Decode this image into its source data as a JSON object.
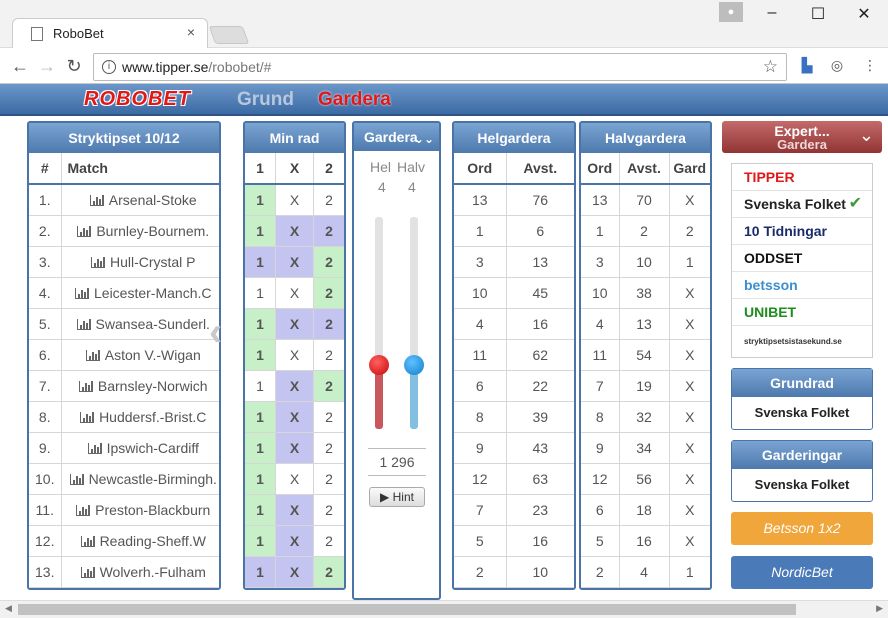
{
  "browser": {
    "tab_title": "RoboBet",
    "url_host": "www.tipper.se",
    "url_path": "/robobet/#"
  },
  "nav": {
    "logo": "ROBOBET",
    "grund": "Grund",
    "gardera": "Gardera"
  },
  "match_panel": {
    "title": "Stryktipset 10/12",
    "col_num": "#",
    "col_match": "Match",
    "rows": [
      {
        "num": "1.",
        "match": "Arsenal-Stoke"
      },
      {
        "num": "2.",
        "match": "Burnley-Bournem."
      },
      {
        "num": "3.",
        "match": "Hull-Crystal P"
      },
      {
        "num": "4.",
        "match": "Leicester-Manch.C"
      },
      {
        "num": "5.",
        "match": "Swansea-Sunderl."
      },
      {
        "num": "6.",
        "match": "Aston V.-Wigan"
      },
      {
        "num": "7.",
        "match": "Barnsley-Norwich"
      },
      {
        "num": "8.",
        "match": "Huddersf.-Brist.C"
      },
      {
        "num": "9.",
        "match": "Ipswich-Cardiff"
      },
      {
        "num": "10.",
        "match": "Newcastle-Birmingh."
      },
      {
        "num": "11.",
        "match": "Preston-Blackburn"
      },
      {
        "num": "12.",
        "match": "Reading-Sheff.W"
      },
      {
        "num": "13.",
        "match": "Wolverh.-Fulham"
      }
    ]
  },
  "minrad": {
    "title": "Min rad",
    "cols": [
      "1",
      "X",
      "2"
    ],
    "rows": [
      [
        "g1",
        "e",
        "e"
      ],
      [
        "g1",
        "bX",
        "b2"
      ],
      [
        "b1",
        "bX",
        "g2"
      ],
      [
        "e",
        "e",
        "g2"
      ],
      [
        "g1",
        "bX",
        "b2"
      ],
      [
        "g1",
        "e",
        "e"
      ],
      [
        "e",
        "bX",
        "g2"
      ],
      [
        "g1",
        "bX",
        "e"
      ],
      [
        "g1",
        "bX",
        "e"
      ],
      [
        "g1",
        "e",
        "e"
      ],
      [
        "g1",
        "bX",
        "e"
      ],
      [
        "g1",
        "bX",
        "e"
      ],
      [
        "b1",
        "bX",
        "g2"
      ]
    ]
  },
  "gardera": {
    "title": "Gardera",
    "hel_label": "Hel",
    "halv_label": "Halv",
    "hel_value": "4",
    "halv_value": "4",
    "hel_level": 0.3,
    "halv_level": 0.3,
    "rows_total": "1 296",
    "hint_label": "Hint"
  },
  "helgardera": {
    "title": "Helgardera",
    "col_ord": "Ord",
    "col_avst": "Avst.",
    "rows": [
      [
        "13",
        "76"
      ],
      [
        "1",
        "6"
      ],
      [
        "3",
        "13"
      ],
      [
        "10",
        "45"
      ],
      [
        "4",
        "16"
      ],
      [
        "11",
        "62"
      ],
      [
        "6",
        "22"
      ],
      [
        "8",
        "39"
      ],
      [
        "9",
        "43"
      ],
      [
        "12",
        "63"
      ],
      [
        "7",
        "23"
      ],
      [
        "5",
        "16"
      ],
      [
        "2",
        "10"
      ]
    ]
  },
  "halvgardera": {
    "title": "Halvgardera",
    "col_ord": "Ord",
    "col_avst": "Avst.",
    "col_gard": "Gard",
    "rows": [
      [
        "13",
        "70",
        "X"
      ],
      [
        "1",
        "2",
        "2"
      ],
      [
        "3",
        "10",
        "1"
      ],
      [
        "10",
        "38",
        "X"
      ],
      [
        "4",
        "13",
        "X"
      ],
      [
        "11",
        "54",
        "X"
      ],
      [
        "7",
        "19",
        "X"
      ],
      [
        "8",
        "32",
        "X"
      ],
      [
        "9",
        "34",
        "X"
      ],
      [
        "12",
        "56",
        "X"
      ],
      [
        "6",
        "18",
        "X"
      ],
      [
        "5",
        "16",
        "X"
      ],
      [
        "2",
        "4",
        "1"
      ]
    ]
  },
  "expert": {
    "title": "Expert...",
    "subtitle": "Gardera",
    "sources": [
      {
        "label": "TIPPER",
        "color": "#e01818"
      },
      {
        "label": "Svenska Folket",
        "color": "#222222"
      },
      {
        "label": "10 Tidningar",
        "color": "#1a2a6a"
      },
      {
        "label": "ODDSET",
        "color": "#111111"
      },
      {
        "label": "betsson",
        "color": "#3a8fd0"
      },
      {
        "label": "UNIBET",
        "color": "#1e8c1e"
      },
      {
        "label": "stryktipsetsistasekund.se",
        "color": "#333333"
      }
    ]
  },
  "grundrad": {
    "title": "Grundrad",
    "source": "Svenska Folket"
  },
  "garderingar": {
    "title": "Garderingar",
    "source": "Svenska Folket"
  },
  "buttons": {
    "betsson": "Betsson 1x2",
    "nordicbet": "NordicBet"
  },
  "colors": {
    "accent": "#4a74a6",
    "green_cell": "#c8f0c8",
    "blue_cell": "#c4c4f0",
    "brand_red": "#e01818",
    "betsson": "#f0a63a",
    "nordicbet": "#4a7ab8"
  }
}
